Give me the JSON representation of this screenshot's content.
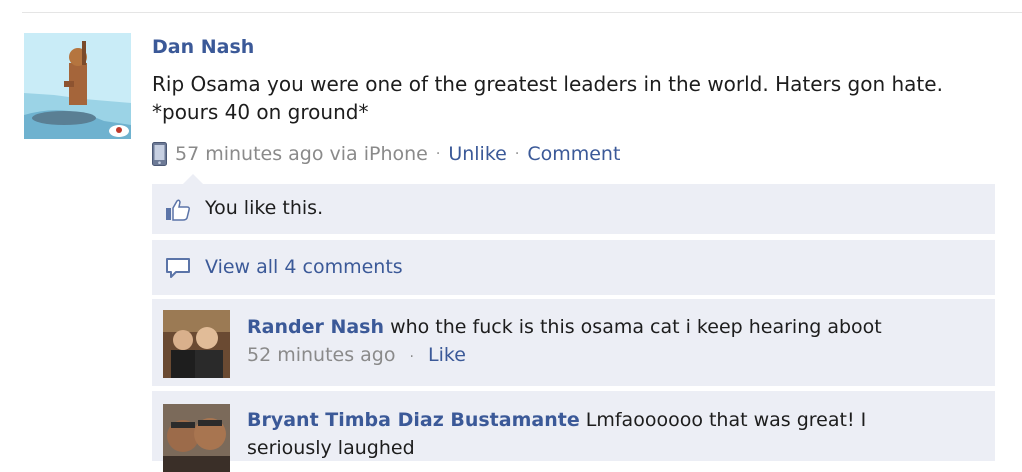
{
  "post": {
    "author": "Dan Nash",
    "text_line1": "Rip Osama you were one of the greatest leaders in the world. Haters gon hate.",
    "text_line2": "*pours 40 on ground*",
    "timestamp": "57 minutes ago via iPhone",
    "unlike_label": "Unlike",
    "comment_label": "Comment",
    "separator": "·"
  },
  "likes": {
    "text": "You like this."
  },
  "view_all": {
    "label": "View all 4 comments"
  },
  "comments": [
    {
      "author": "Rander Nash",
      "text": "who the fuck is this osama cat i keep hearing aboot",
      "timestamp": "52 minutes ago",
      "like_label": "Like"
    },
    {
      "author": "Bryant Timba Diaz Bustamante",
      "text": "Lmfaoooooo that was great! I",
      "text_cont": "seriously laughed"
    }
  ],
  "icons": {
    "phone": "phone-icon",
    "like": "thumbs-up-icon",
    "comments": "speech-bubble-icon"
  },
  "colors": {
    "link": "#3b5998",
    "panel": "#eceef5",
    "meta": "#8a8a8a"
  }
}
